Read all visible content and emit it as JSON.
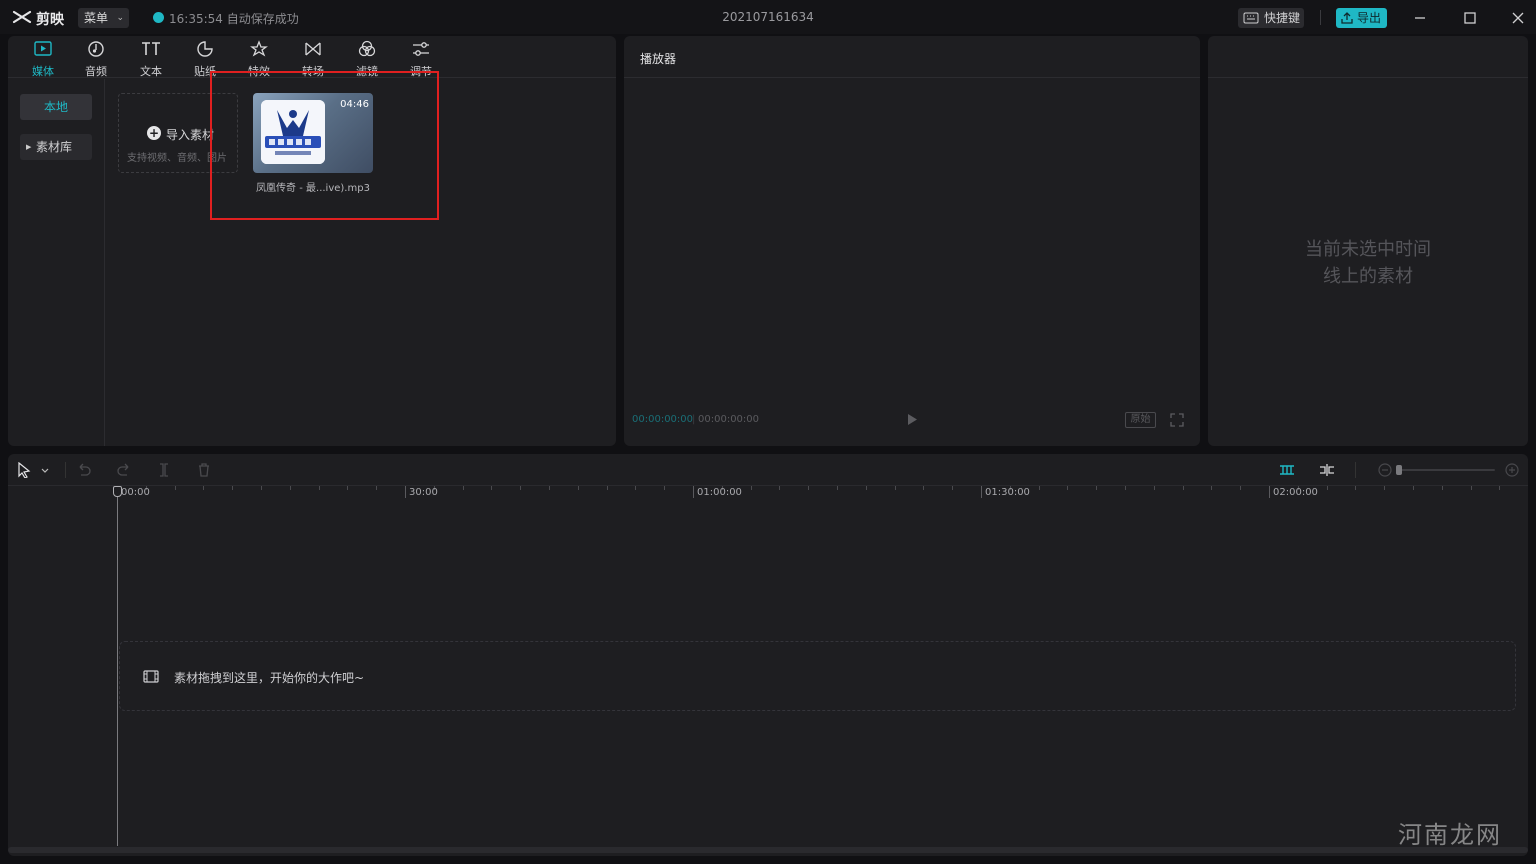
{
  "titlebar": {
    "app_name": "剪映",
    "menu_label": "菜单",
    "save_time": "16:35:54",
    "save_status": "自动保存成功",
    "project_title": "202107161634",
    "shortcut_label": "快捷键",
    "export_label": "导出"
  },
  "media": {
    "tabs": [
      {
        "label": "媒体",
        "icon": "media-icon",
        "active": true
      },
      {
        "label": "音频",
        "icon": "audio-icon",
        "active": false
      },
      {
        "label": "文本",
        "icon": "text-icon",
        "active": false
      },
      {
        "label": "贴纸",
        "icon": "sticker-icon",
        "active": false
      },
      {
        "label": "特效",
        "icon": "effects-icon",
        "active": false
      },
      {
        "label": "转场",
        "icon": "transition-icon",
        "active": false
      },
      {
        "label": "滤镜",
        "icon": "filter-icon",
        "active": false
      },
      {
        "label": "调节",
        "icon": "adjust-icon",
        "active": false
      }
    ],
    "sidebar": {
      "local_label": "本地",
      "library_label": "素材库"
    },
    "import": {
      "title": "导入素材",
      "hint": "支持视频、音频、图片"
    },
    "items": [
      {
        "name": "凤凰传奇 - 最...ive).mp3",
        "duration": "04:46"
      }
    ]
  },
  "player": {
    "title": "播放器",
    "current_time": "00:00:00:00",
    "total_time": "00:00:00:00",
    "ratio_label": "原始"
  },
  "properties": {
    "empty_line1": "当前未选中时间",
    "empty_line2": "线上的素材"
  },
  "timeline": {
    "ruler_labels": [
      "00:00",
      "30:00",
      "01:00:00",
      "01:30:00",
      "02:00:00"
    ],
    "drop_hint": "素材拖拽到这里，开始你的大作吧~"
  },
  "watermark": "河南龙网",
  "colors": {
    "accent": "#1fb8c5",
    "highlight_box": "#e02020",
    "panel": "#1e1e21",
    "background": "#101013"
  }
}
